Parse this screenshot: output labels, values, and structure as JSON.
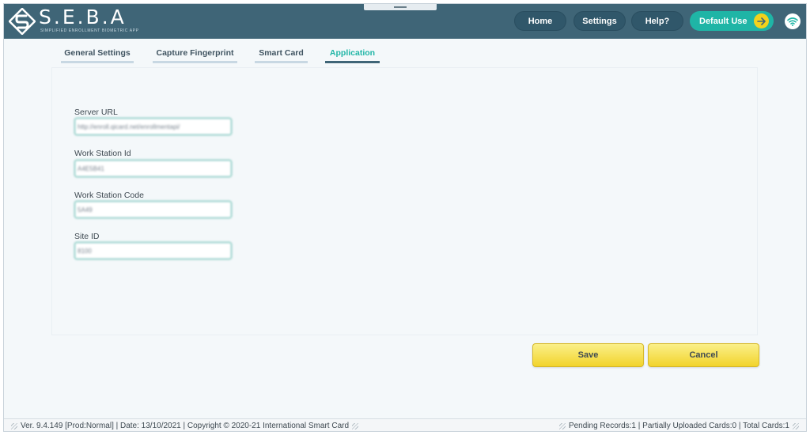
{
  "app": {
    "logo_title": "S.E.B.A",
    "logo_subtitle": "SIMPLIFIED ENROLLMENT BIOMETRIC APP"
  },
  "nav": {
    "home": "Home",
    "settings": "Settings",
    "help": "Help?",
    "user": "Default Use"
  },
  "tabs": [
    {
      "label": "General Settings"
    },
    {
      "label": "Capture Fingerprint"
    },
    {
      "label": "Smart Card"
    },
    {
      "label": "Application"
    }
  ],
  "form": {
    "server_url": {
      "label": "Server URL",
      "value": "http://enroll.qicard.net/enrollmentapi/"
    },
    "work_station_id": {
      "label": "Work Station Id",
      "value": "A4E5B41"
    },
    "work_station_code": {
      "label": "Work Station Code",
      "value": "5A49"
    },
    "site_id": {
      "label": "Site ID",
      "value": "8100"
    }
  },
  "actions": {
    "save": "Save",
    "cancel": "Cancel"
  },
  "status": {
    "left": "Ver. 9.4.149 [Prod:Normal] | Date: 13/10/2021 | Copyright © 2020-21 International Smart Card",
    "right": "Pending Records:1 | Partially Uploaded Cards:0 | Total Cards:1"
  },
  "colors": {
    "header": "#3f6577",
    "accent_teal": "#1fb5a6",
    "button_yellow": "#f2d42c"
  }
}
